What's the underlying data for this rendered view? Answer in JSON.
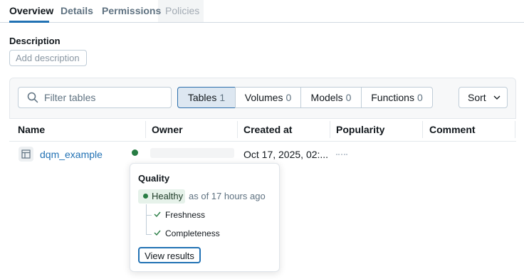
{
  "tabs": [
    {
      "label": "Overview",
      "state": "active"
    },
    {
      "label": "Details",
      "state": "default"
    },
    {
      "label": "Permissions",
      "state": "default"
    },
    {
      "label": "Policies",
      "state": "disabled"
    }
  ],
  "description": {
    "title": "Description",
    "add_label": "Add description"
  },
  "toolbar": {
    "search_placeholder": "Filter tables",
    "segments": [
      {
        "label": "Tables",
        "count": "1",
        "active": true
      },
      {
        "label": "Volumes",
        "count": "0",
        "active": false
      },
      {
        "label": "Models",
        "count": "0",
        "active": false
      },
      {
        "label": "Functions",
        "count": "0",
        "active": false
      }
    ],
    "sort_label": "Sort"
  },
  "table": {
    "columns": [
      "Name",
      "Owner",
      "Created at",
      "Popularity",
      "Comment"
    ],
    "rows": [
      {
        "name": "dqm_example",
        "owner": "",
        "created_at": "Oct 17, 2025, 02:...",
        "popularity": "",
        "comment": ""
      }
    ]
  },
  "quality_popover": {
    "title": "Quality",
    "status": "Healthy",
    "as_of": "as of 17 hours ago",
    "checks": [
      "Freshness",
      "Completeness"
    ],
    "action_label": "View results"
  },
  "colors": {
    "accent": "#2272b4",
    "healthy": "#277c43",
    "healthy_bg": "#e6f2ea",
    "active_segment_bg": "#dde7f1"
  },
  "icons": {
    "search": "search-icon",
    "table": "table-icon",
    "sort": "chevron-down-icon",
    "check": "check-icon"
  }
}
